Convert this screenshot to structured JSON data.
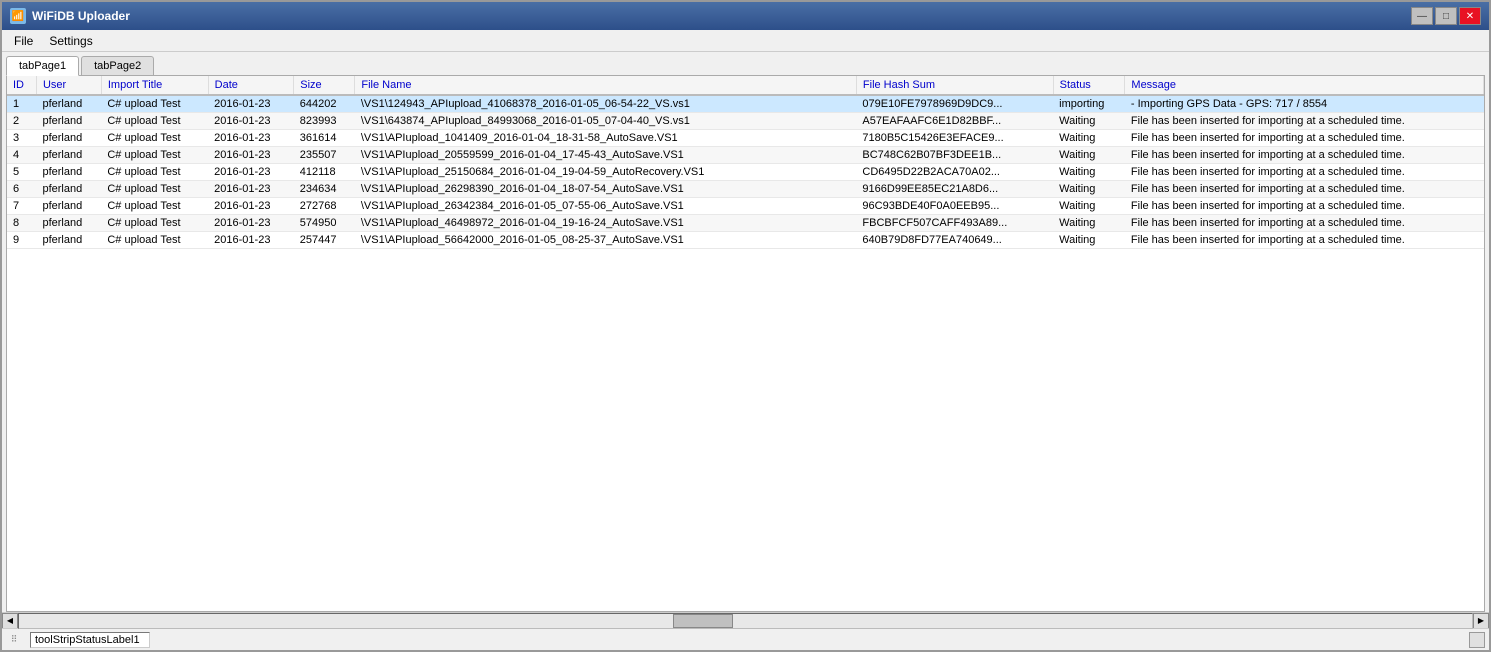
{
  "window": {
    "title": "WiFiDB Uploader",
    "icon": "wifi-icon"
  },
  "titlebar": {
    "minimize_label": "—",
    "maximize_label": "□",
    "close_label": "✕"
  },
  "menu": {
    "items": [
      {
        "label": "File",
        "id": "file"
      },
      {
        "label": "Settings",
        "id": "settings"
      }
    ]
  },
  "tabs": [
    {
      "label": "tabPage1",
      "active": true
    },
    {
      "label": "tabPage2",
      "active": false
    }
  ],
  "table": {
    "columns": [
      {
        "label": "ID",
        "key": "id"
      },
      {
        "label": "User",
        "key": "user"
      },
      {
        "label": "Import Title",
        "key": "import_title"
      },
      {
        "label": "Date",
        "key": "date"
      },
      {
        "label": "Size",
        "key": "size"
      },
      {
        "label": "File Name",
        "key": "file_name"
      },
      {
        "label": "File Hash Sum",
        "key": "hash"
      },
      {
        "label": "Status",
        "key": "status"
      },
      {
        "label": "Message",
        "key": "message"
      }
    ],
    "rows": [
      {
        "id": "1",
        "user": "pferland",
        "import_title": "C# upload Test",
        "date": "2016-01-23",
        "size": "644202",
        "file_name": "\\VS1\\124943_APIupload_41068378_2016-01-05_06-54-22_VS.vs1",
        "hash": "079E10FE7978969D9DC9...",
        "status": "importing",
        "message": "- Importing GPS Data - GPS: 717 / 8554",
        "selected": true
      },
      {
        "id": "2",
        "user": "pferland",
        "import_title": "C# upload Test",
        "date": "2016-01-23",
        "size": "823993",
        "file_name": "\\VS1\\643874_APIupload_84993068_2016-01-05_07-04-40_VS.vs1",
        "hash": "A57EAFAAFC6E1D82BBF...",
        "status": "Waiting",
        "message": "File has been inserted for importing at a scheduled time."
      },
      {
        "id": "3",
        "user": "pferland",
        "import_title": "C# upload Test",
        "date": "2016-01-23",
        "size": "361614",
        "file_name": "\\VS1\\APIupload_1041409_2016-01-04_18-31-58_AutoSave.VS1",
        "hash": "7180B5C15426E3EFACE9...",
        "status": "Waiting",
        "message": "File has been inserted for importing at a scheduled time."
      },
      {
        "id": "4",
        "user": "pferland",
        "import_title": "C# upload Test",
        "date": "2016-01-23",
        "size": "235507",
        "file_name": "\\VS1\\APIupload_20559599_2016-01-04_17-45-43_AutoSave.VS1",
        "hash": "BC748C62B07BF3DEE1B...",
        "status": "Waiting",
        "message": "File has been inserted for importing at a scheduled time."
      },
      {
        "id": "5",
        "user": "pferland",
        "import_title": "C# upload Test",
        "date": "2016-01-23",
        "size": "412118",
        "file_name": "\\VS1\\APIupload_25150684_2016-01-04_19-04-59_AutoRecovery.VS1",
        "hash": "CD6495D22B2ACA70A02...",
        "status": "Waiting",
        "message": "File has been inserted for importing at a scheduled time."
      },
      {
        "id": "6",
        "user": "pferland",
        "import_title": "C# upload Test",
        "date": "2016-01-23",
        "size": "234634",
        "file_name": "\\VS1\\APIupload_26298390_2016-01-04_18-07-54_AutoSave.VS1",
        "hash": "9166D99EE85EC21A8D6...",
        "status": "Waiting",
        "message": "File has been inserted for importing at a scheduled time."
      },
      {
        "id": "7",
        "user": "pferland",
        "import_title": "C# upload Test",
        "date": "2016-01-23",
        "size": "272768",
        "file_name": "\\VS1\\APIupload_26342384_2016-01-05_07-55-06_AutoSave.VS1",
        "hash": "96C93BDE40F0A0EEB95...",
        "status": "Waiting",
        "message": "File has been inserted for importing at a scheduled time."
      },
      {
        "id": "8",
        "user": "pferland",
        "import_title": "C# upload Test",
        "date": "2016-01-23",
        "size": "574950",
        "file_name": "\\VS1\\APIupload_46498972_2016-01-04_19-16-24_AutoSave.VS1",
        "hash": "FBCBFCF507CAFF493A89...",
        "status": "Waiting",
        "message": "File has been inserted for importing at a scheduled time."
      },
      {
        "id": "9",
        "user": "pferland",
        "import_title": "C# upload Test",
        "date": "2016-01-23",
        "size": "257447",
        "file_name": "\\VS1\\APIupload_56642000_2016-01-05_08-25-37_AutoSave.VS1",
        "hash": "640B79D8FD77EA740649...",
        "status": "Waiting",
        "message": "File has been inserted for importing at a scheduled time."
      }
    ]
  },
  "statusbar": {
    "label": "toolStripStatusLabel1"
  }
}
